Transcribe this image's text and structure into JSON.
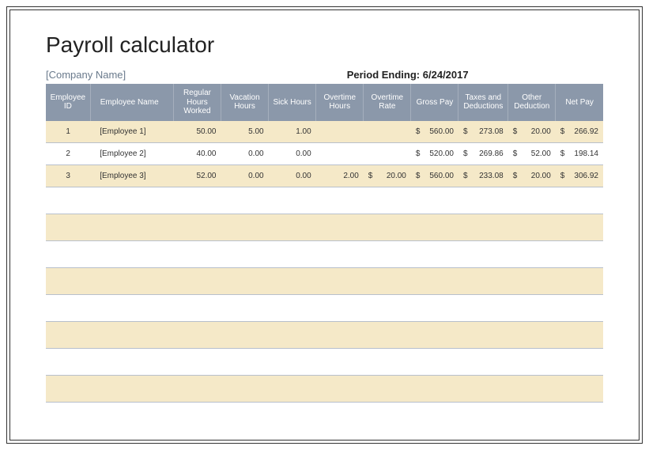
{
  "title": "Payroll calculator",
  "company": "[Company Name]",
  "period_label": "Period Ending:",
  "period_value": "6/24/2017",
  "columns": [
    "Employee ID",
    "Employee Name",
    "Regular Hours Worked",
    "Vacation Hours",
    "Sick Hours",
    "Overtime Hours",
    "Overtime Rate",
    "Gross Pay",
    "Taxes and Deductions",
    "Other Deduction",
    "Net Pay"
  ],
  "rows": [
    {
      "id": "1",
      "name": "[Employee 1]",
      "reg": "50.00",
      "vac": "5.00",
      "sick": "1.00",
      "oth": "",
      "otr": "",
      "gross": "560.00",
      "tax": "273.08",
      "other": "20.00",
      "net": "266.92"
    },
    {
      "id": "2",
      "name": "[Employee 2]",
      "reg": "40.00",
      "vac": "0.00",
      "sick": "0.00",
      "oth": "",
      "otr": "",
      "gross": "520.00",
      "tax": "269.86",
      "other": "52.00",
      "net": "198.14"
    },
    {
      "id": "3",
      "name": "[Employee 3]",
      "reg": "52.00",
      "vac": "0.00",
      "sick": "0.00",
      "oth": "2.00",
      "otr": "20.00",
      "gross": "560.00",
      "tax": "233.08",
      "other": "20.00",
      "net": "306.92"
    }
  ],
  "currency_symbol": "$",
  "chart_data": {
    "type": "table",
    "title": "Payroll calculator",
    "columns": [
      "Employee ID",
      "Employee Name",
      "Regular Hours Worked",
      "Vacation Hours",
      "Sick Hours",
      "Overtime Hours",
      "Overtime Rate",
      "Gross Pay",
      "Taxes and Deductions",
      "Other Deduction",
      "Net Pay"
    ],
    "data": [
      [
        1,
        "[Employee 1]",
        50.0,
        5.0,
        1.0,
        null,
        null,
        560.0,
        273.08,
        20.0,
        266.92
      ],
      [
        2,
        "[Employee 2]",
        40.0,
        0.0,
        0.0,
        null,
        null,
        520.0,
        269.86,
        52.0,
        198.14
      ],
      [
        3,
        "[Employee 3]",
        52.0,
        0.0,
        0.0,
        2.0,
        20.0,
        560.0,
        233.08,
        20.0,
        306.92
      ]
    ]
  }
}
